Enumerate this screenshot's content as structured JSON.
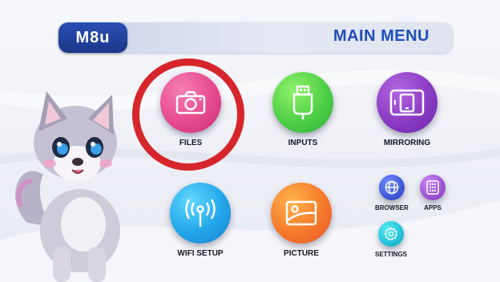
{
  "header": {
    "logo_text": "M8u",
    "title": "MAIN MENU"
  },
  "menu": {
    "files": {
      "label": "FILES",
      "icon": "camera-icon",
      "color": "#e64a8e"
    },
    "inputs": {
      "label": "INPUTS",
      "icon": "usb-plug-icon",
      "color": "#4fcf46"
    },
    "mirroring": {
      "label": "MIRRORING",
      "icon": "tablet-phone-icon",
      "color": "#8a3cc4"
    },
    "wifi_setup": {
      "label": "WIFI SETUP",
      "icon": "wifi-antenna-icon",
      "color": "#21a6ea"
    },
    "picture": {
      "label": "PICTURE",
      "icon": "picture-icon",
      "color": "#f57a2a"
    },
    "browser": {
      "label": "BROWSER",
      "icon": "globe-icon",
      "color": "#4059d8"
    },
    "apps": {
      "label": "APPS",
      "icon": "apps-grid-icon",
      "color": "#9b52d2"
    },
    "settings": {
      "label": "SETTINGS",
      "icon": "gear-icon",
      "color": "#22c2d8"
    }
  },
  "selection": {
    "selected_item": "files",
    "ring_color": "#d6262b"
  },
  "mascot": {
    "icon": "wolf-puppy-mascot"
  }
}
